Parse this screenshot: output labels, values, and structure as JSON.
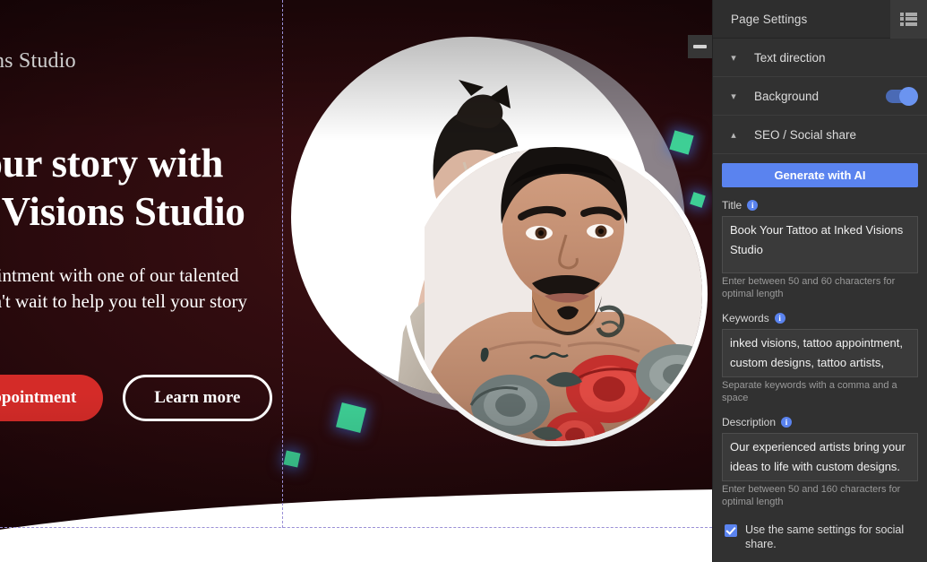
{
  "canvas": {
    "site": {
      "brand_line": "Inked Visions Studio",
      "headline_line1": "Ink your story with",
      "headline_line2": "Inked Visions Studio",
      "subtext": "Book an appointment with one of our talented artists. We can't wait to help you tell your story in ink!",
      "primary_button": "Book an appointment",
      "secondary_button": "Learn more"
    },
    "colors": {
      "background": "#2a0a0d",
      "primary_button": "#d42b28",
      "accent_shape": "#3ecf95",
      "arc": "#8b8289",
      "guide": "#9a8fd6"
    },
    "collapse_button_icon": "minus-icon"
  },
  "panel": {
    "title": "Page Settings",
    "header_icon": "layers-list-icon",
    "accordions": [
      {
        "label": "Text direction",
        "chevron": "chevron-down-icon",
        "expanded": false
      },
      {
        "label": "Background",
        "chevron": "chevron-down-icon",
        "expanded": false,
        "toggle": "on"
      },
      {
        "label": "SEO / Social share",
        "chevron": "chevron-up-icon",
        "expanded": true
      }
    ],
    "seo": {
      "generate_button": "Generate with AI",
      "title_field": {
        "label": "Title",
        "info_icon": "info-icon",
        "value": "Book Your Tattoo at Inked Visions Studio",
        "hint": "Enter between 50 and 60 characters for optimal length"
      },
      "keywords_field": {
        "label": "Keywords",
        "info_icon": "info-icon",
        "value": "inked visions, tattoo appointment, custom designs, tattoo artists, book tattoo",
        "hint": "Separate keywords with a comma and a space"
      },
      "description_field": {
        "label": "Description",
        "info_icon": "info-icon",
        "value": "Our experienced artists bring your ideas to life with custom designs. Schedule your appointment today.",
        "hint": "Enter between 50 and 160 characters for optimal length"
      },
      "social_checkbox": {
        "label": "Use the same settings for social share.",
        "checked": true
      }
    },
    "colors": {
      "panel_bg": "#313131",
      "accent": "#5a83ef",
      "toggle_on": "#6b94f0"
    }
  }
}
